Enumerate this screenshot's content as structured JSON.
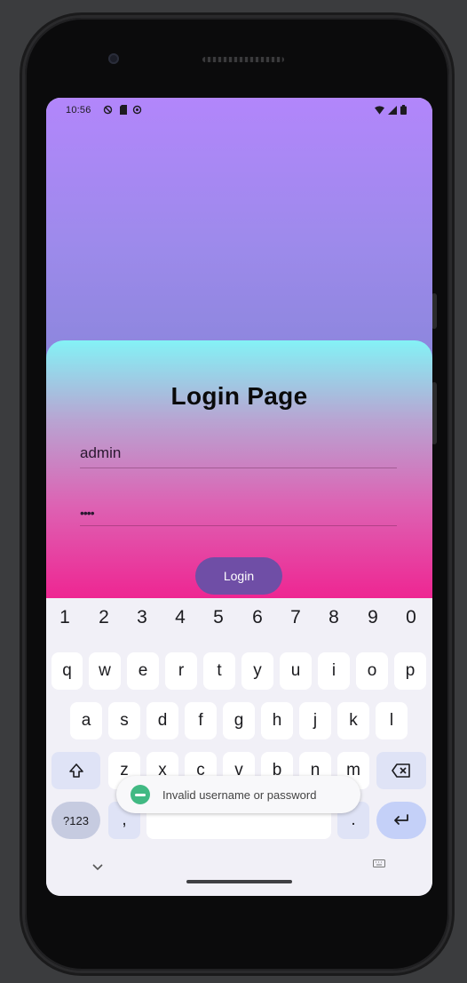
{
  "status_bar": {
    "time": "10:56",
    "left_icons": [
      "sync-icon",
      "sd-card-icon",
      "record-icon"
    ],
    "right_icons": [
      "wifi-icon",
      "signal-icon",
      "battery-icon"
    ]
  },
  "login": {
    "title": "Login Page",
    "username_value": "admin",
    "password_value": "••••",
    "button_label": "Login"
  },
  "keyboard": {
    "numbers": [
      "1",
      "2",
      "3",
      "4",
      "5",
      "6",
      "7",
      "8",
      "9",
      "0"
    ],
    "row1": [
      "q",
      "w",
      "e",
      "r",
      "t",
      "y",
      "u",
      "i",
      "o",
      "p"
    ],
    "row2": [
      "a",
      "s",
      "d",
      "f",
      "g",
      "h",
      "j",
      "k",
      "l"
    ],
    "row3": [
      "z",
      "x",
      "c",
      "v",
      "b",
      "n",
      "m"
    ],
    "symbols_label": "?123",
    "comma": ",",
    "period": "."
  },
  "toast": {
    "message": "Invalid username or password"
  },
  "colors": {
    "top_gradient": [
      "#b286fb",
      "#8b86dc"
    ],
    "card_gradient": [
      "#84f2f6",
      "#dd62b3",
      "#f0208f"
    ],
    "button": "#6f4ea6",
    "toast_icon": "#41b983"
  }
}
